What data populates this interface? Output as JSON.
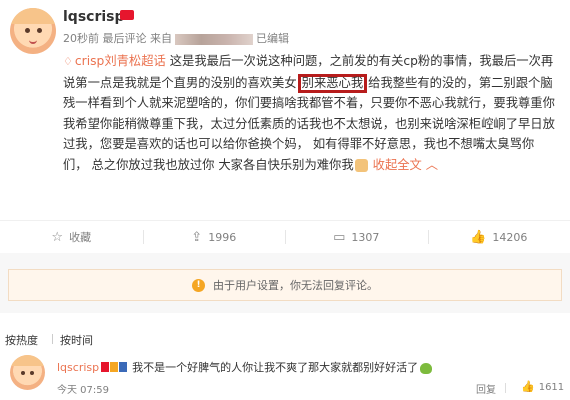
{
  "post": {
    "username": "lqscrisp",
    "meta_time": "20秒前 最后评论 来自",
    "meta_edited": "已编辑",
    "topic": "crisp刘青松超话",
    "text_before": " 这是我最后一次说这种问题，之前发的有关cp粉的事情，我最后一次再说第一点是我就是个直男的没别的喜欢美女",
    "highlight": "别来恶心我",
    "text_after": "给我整些有的没的，第二别跟个脑残一样看到个人就来泥塑啥的，你们要搞啥我都管不着，只要你不恶心我就行，要我尊重你我希望你能稍微尊重下我，太过分低素质的话我也不太想说，也别来说啥深柜崆峒了早日放过我，您要是喜欢的话也可以给你爸换个妈，  如有得罪不好意思，我也不想嘴太臭骂你们，  总之你放过我也放过你 大家各自快乐别为难你我",
    "collapse": "收起全文"
  },
  "actions": {
    "favorite": "收藏",
    "repost": "1996",
    "comment": "1307",
    "like": "14206"
  },
  "notice": "由于用户设置，你无法回复评论。",
  "sort": {
    "hot": "按热度",
    "time": "按时间"
  },
  "comment": {
    "user": "lqscrisp",
    "text": "我不是一个好脾气的人你让我不爽了那大家就都别好好活了",
    "time": "今天 07:59",
    "reply": "回复",
    "likes": "1611"
  }
}
